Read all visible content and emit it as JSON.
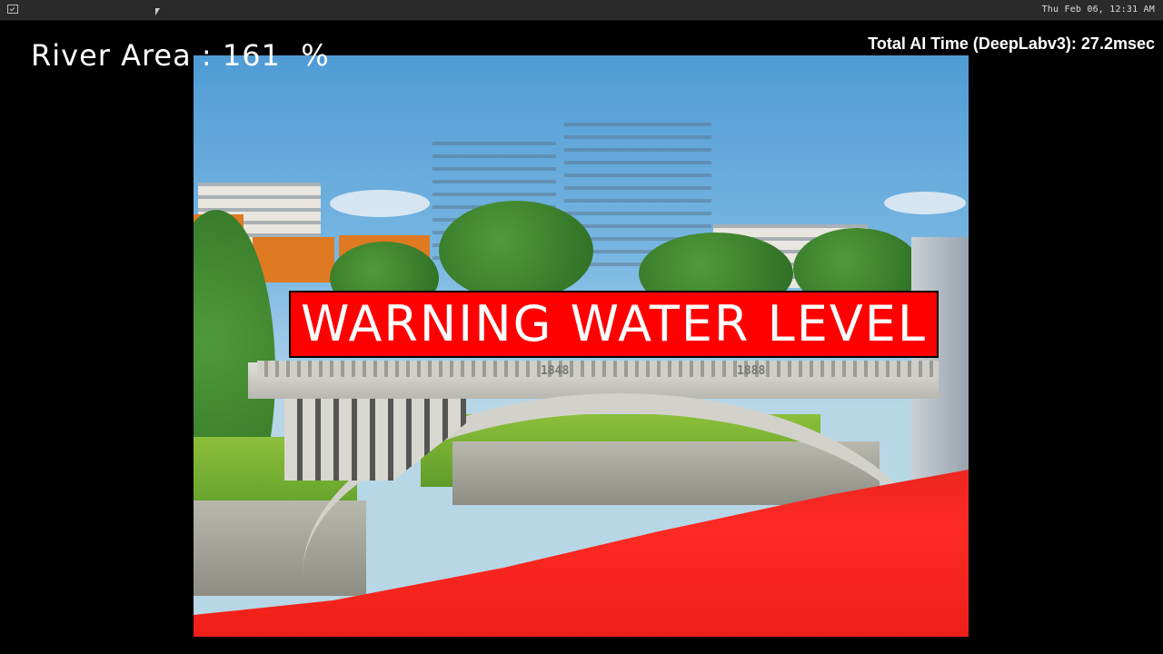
{
  "topbar": {
    "clock": "Thu Feb 06, 12:31 AM",
    "terminal_icon": "terminal-icon",
    "cursor_icon": "cursor-icon"
  },
  "overlay": {
    "river_area": "River Area : 161  %",
    "ai_time": "Total AI Time (DeepLabv3): 27.2msec",
    "warning": "WARNING WATER LEVEL"
  },
  "scene": {
    "bridge_years": [
      "1848",
      "1888"
    ],
    "colors": {
      "segmentation_mask": "#ff0000",
      "warning_bg": "#ff0000",
      "sky": "#79b7e2"
    }
  }
}
